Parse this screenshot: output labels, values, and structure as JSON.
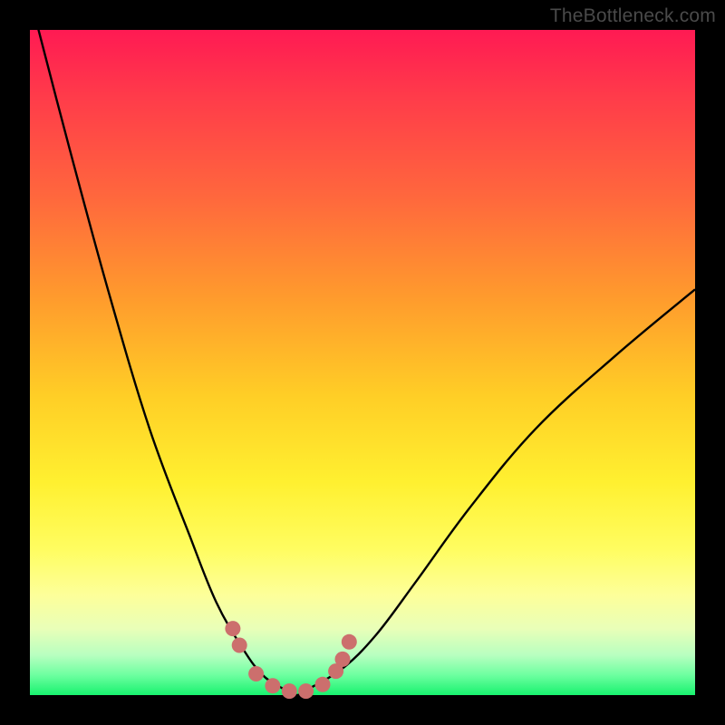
{
  "watermark": "TheBottleneck.com",
  "colors": {
    "background": "#000000",
    "curve": "#000000",
    "marker_fill": "#cc6f6d",
    "gradient_top": "#ff1a53",
    "gradient_bottom": "#18f26e"
  },
  "chart_data": {
    "type": "line",
    "title": "",
    "xlabel": "",
    "ylabel": "",
    "xlim": [
      0,
      100
    ],
    "ylim": [
      0,
      100
    ],
    "note": "No axes, ticks, or numeric labels visible; values below are approximate normalized percentages read from curve position (y=0 at bottom, y=100 at top).",
    "series": [
      {
        "name": "curve",
        "x": [
          0,
          6,
          12,
          18,
          24,
          28,
          32,
          35,
          38,
          40,
          42,
          47,
          52,
          58,
          66,
          76,
          88,
          100
        ],
        "y": [
          105,
          82,
          60,
          40,
          24,
          14,
          7,
          3,
          1,
          0,
          1,
          4,
          9,
          17,
          28,
          40,
          51,
          61
        ]
      }
    ],
    "markers": {
      "name": "highlighted-points",
      "symbol": "circle",
      "color": "#cc6f6d",
      "x": [
        30.5,
        31.5,
        34,
        36.5,
        39,
        41.5,
        44,
        46,
        47,
        48
      ],
      "y": [
        10,
        7.5,
        3.2,
        1.4,
        0.6,
        0.6,
        1.6,
        3.6,
        5.4,
        8
      ]
    }
  }
}
